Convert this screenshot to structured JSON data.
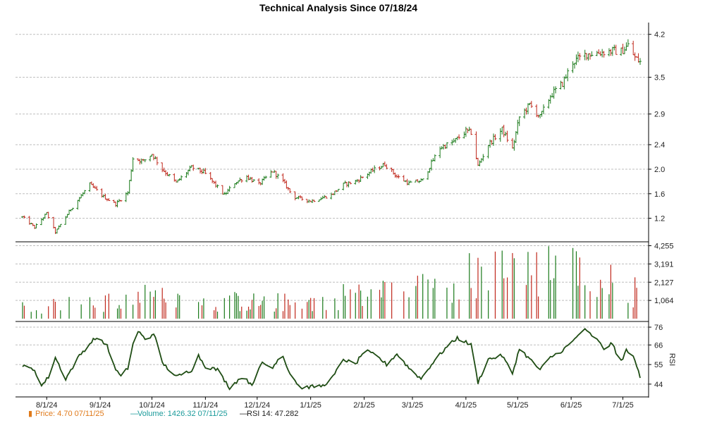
{
  "chart_data": {
    "type": "ohlc",
    "title": "Technical Analysis Since 07/18/24",
    "x_labels": [
      "8/1/24",
      "9/1/24",
      "10/1/24",
      "11/1/24",
      "12/1/24",
      "1/1/25",
      "2/1/25",
      "3/1/25",
      "4/1/25",
      "5/1/25",
      "6/1/25",
      "7/1/25"
    ],
    "x_range": [
      "2024-07-18",
      "2025-07-11"
    ],
    "grid": true,
    "colors": {
      "up": "#1a7a1a",
      "down": "#c0281c",
      "rsi": "#1f4d14",
      "volume_axis": "#1a9a9a",
      "price_legend": "#e07a1a",
      "grid": "#bdbdbd"
    },
    "price_panel": {
      "ylim": [
        0.85,
        4.3
      ],
      "y_ticks": [
        "1.2",
        "1.6",
        "2.0",
        "2.4",
        "2.9",
        "3.5",
        "4.2"
      ],
      "y_tick_values": [
        1.2,
        1.6,
        2.0,
        2.4,
        2.9,
        3.5,
        4.2
      ],
      "key_points": [
        [
          "2024-07-18",
          1.22
        ],
        [
          "2024-07-25",
          1.05
        ],
        [
          "2024-08-01",
          1.28
        ],
        [
          "2024-08-06",
          0.97
        ],
        [
          "2024-08-15",
          1.35
        ],
        [
          "2024-08-26",
          1.75
        ],
        [
          "2024-09-03",
          1.55
        ],
        [
          "2024-09-10",
          1.43
        ],
        [
          "2024-09-17",
          1.62
        ],
        [
          "2024-09-20",
          2.18
        ],
        [
          "2024-09-26",
          2.13
        ],
        [
          "2024-10-01",
          2.25
        ],
        [
          "2024-10-07",
          2.0
        ],
        [
          "2024-10-15",
          1.78
        ],
        [
          "2024-10-24",
          2.03
        ],
        [
          "2024-10-31",
          1.95
        ],
        [
          "2024-11-05",
          1.8
        ],
        [
          "2024-11-12",
          1.58
        ],
        [
          "2024-11-18",
          1.78
        ],
        [
          "2024-11-25",
          1.88
        ],
        [
          "2024-12-02",
          1.75
        ],
        [
          "2024-12-10",
          1.97
        ],
        [
          "2024-12-16",
          1.8
        ],
        [
          "2024-12-22",
          1.55
        ],
        [
          "2025-01-01",
          1.48
        ],
        [
          "2025-01-13",
          1.58
        ],
        [
          "2025-01-20",
          1.75
        ],
        [
          "2025-01-27",
          1.8
        ],
        [
          "2025-02-06",
          1.98
        ],
        [
          "2025-02-13",
          2.08
        ],
        [
          "2025-02-20",
          1.88
        ],
        [
          "2025-02-27",
          1.77
        ],
        [
          "2025-03-07",
          1.82
        ],
        [
          "2025-03-12",
          2.1
        ],
        [
          "2025-03-17",
          2.35
        ],
        [
          "2025-03-25",
          2.45
        ],
        [
          "2025-04-01",
          2.62
        ],
        [
          "2025-04-04",
          2.6
        ],
        [
          "2025-04-08",
          2.05
        ],
        [
          "2025-04-14",
          2.4
        ],
        [
          "2025-04-22",
          2.65
        ],
        [
          "2025-04-28",
          2.33
        ],
        [
          "2025-05-02",
          2.85
        ],
        [
          "2025-05-08",
          3.05
        ],
        [
          "2025-05-14",
          2.85
        ],
        [
          "2025-05-20",
          3.2
        ],
        [
          "2025-05-27",
          3.4
        ],
        [
          "2025-06-02",
          3.75
        ],
        [
          "2025-06-10",
          3.88
        ],
        [
          "2025-06-17",
          3.9
        ],
        [
          "2025-06-25",
          3.93
        ],
        [
          "2025-06-30",
          3.92
        ],
        [
          "2025-07-04",
          4.02
        ],
        [
          "2025-07-08",
          3.82
        ],
        [
          "2025-07-11",
          3.75
        ]
      ]
    },
    "volume_panel": {
      "ylim": [
        0,
        4400
      ],
      "y_ticks": [
        "1,064",
        "2,127",
        "3,191",
        "4,255"
      ],
      "y_tick_values": [
        1064,
        2127,
        3191,
        4255
      ],
      "key_points": [
        [
          "2024-07-18",
          700
        ],
        [
          "2024-08-15",
          800
        ],
        [
          "2024-09-15",
          900
        ],
        [
          "2024-10-01",
          1300
        ],
        [
          "2024-11-01",
          1000
        ],
        [
          "2024-12-01",
          900
        ],
        [
          "2025-01-01",
          900
        ],
        [
          "2025-02-01",
          1500
        ],
        [
          "2025-03-01",
          1500
        ],
        [
          "2025-04-01",
          2300
        ],
        [
          "2025-05-01",
          2500
        ],
        [
          "2025-06-01",
          2600
        ],
        [
          "2025-07-11",
          1426
        ]
      ]
    },
    "rsi_panel": {
      "ylim": [
        38,
        78
      ],
      "y_ticks": [
        "44",
        "55",
        "66",
        "76"
      ],
      "y_tick_values": [
        44,
        55,
        66,
        76
      ],
      "axis_label": "RSI",
      "key_points": [
        [
          "2024-07-18",
          54
        ],
        [
          "2024-07-25",
          52
        ],
        [
          "2024-07-29",
          43
        ],
        [
          "2024-08-02",
          48
        ],
        [
          "2024-08-06",
          59
        ],
        [
          "2024-08-12",
          47
        ],
        [
          "2024-08-20",
          60
        ],
        [
          "2024-08-29",
          70
        ],
        [
          "2024-09-05",
          66
        ],
        [
          "2024-09-09",
          54
        ],
        [
          "2024-09-13",
          48
        ],
        [
          "2024-09-17",
          53
        ],
        [
          "2024-09-22",
          75
        ],
        [
          "2024-09-28",
          68
        ],
        [
          "2024-10-02",
          73
        ],
        [
          "2024-10-07",
          56
        ],
        [
          "2024-10-15",
          48
        ],
        [
          "2024-10-24",
          52
        ],
        [
          "2024-10-28",
          60
        ],
        [
          "2024-11-01",
          54
        ],
        [
          "2024-11-08",
          52
        ],
        [
          "2024-11-15",
          42
        ],
        [
          "2024-11-22",
          48
        ],
        [
          "2024-11-28",
          44
        ],
        [
          "2024-12-04",
          56
        ],
        [
          "2024-12-10",
          53
        ],
        [
          "2024-12-15",
          62
        ],
        [
          "2024-12-20",
          50
        ],
        [
          "2024-12-26",
          42
        ],
        [
          "2025-01-08",
          43
        ],
        [
          "2025-01-14",
          48
        ],
        [
          "2025-01-20",
          58
        ],
        [
          "2025-01-27",
          55
        ],
        [
          "2025-02-01",
          63
        ],
        [
          "2025-02-08",
          60
        ],
        [
          "2025-02-14",
          55
        ],
        [
          "2025-02-20",
          61
        ],
        [
          "2025-02-27",
          53
        ],
        [
          "2025-03-06",
          47
        ],
        [
          "2025-03-12",
          55
        ],
        [
          "2025-03-20",
          64
        ],
        [
          "2025-03-27",
          70
        ],
        [
          "2025-04-04",
          66
        ],
        [
          "2025-04-08",
          45
        ],
        [
          "2025-04-14",
          58
        ],
        [
          "2025-04-22",
          60
        ],
        [
          "2025-04-28",
          50
        ],
        [
          "2025-05-02",
          64
        ],
        [
          "2025-05-08",
          58
        ],
        [
          "2025-05-14",
          52
        ],
        [
          "2025-05-20",
          59
        ],
        [
          "2025-05-27",
          63
        ],
        [
          "2025-06-02",
          68
        ],
        [
          "2025-06-08",
          75
        ],
        [
          "2025-06-15",
          70
        ],
        [
          "2025-06-20",
          64
        ],
        [
          "2025-06-25",
          67
        ],
        [
          "2025-06-29",
          55
        ],
        [
          "2025-07-03",
          63
        ],
        [
          "2025-07-08",
          58
        ],
        [
          "2025-07-11",
          47
        ]
      ]
    },
    "legend": [
      {
        "marker": "▮",
        "label": "Price: 4.70  07/11/25",
        "color": "#e07a1a"
      },
      {
        "marker": "—",
        "label": "Volume: 1426.32  07/11/25",
        "color": "#1a9a9a"
      },
      {
        "marker": "—",
        "label": "RSI 14: 47.282",
        "color": "#222222"
      }
    ]
  }
}
